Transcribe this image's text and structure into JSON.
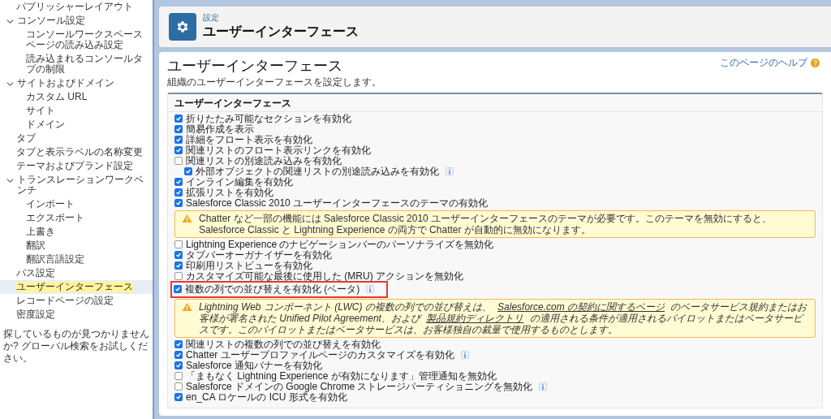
{
  "sidebar": {
    "items": [
      {
        "label": "パブリッシャーレイアウト",
        "selected": false
      },
      {
        "label": "コンソール設定",
        "expanded": true,
        "selected": false,
        "children": [
          {
            "label": "コンソールワークスペースページの読み込み設定",
            "selected": false
          },
          {
            "label": "読み込まれるコンソールタブの制限",
            "selected": false
          }
        ]
      },
      {
        "label": "サイトおよびドメイン",
        "expanded": true,
        "selected": false,
        "children": [
          {
            "label": "カスタム URL",
            "selected": false
          },
          {
            "label": "サイト",
            "selected": false
          },
          {
            "label": "ドメイン",
            "selected": false
          }
        ]
      },
      {
        "label": "タブ",
        "selected": false
      },
      {
        "label": "タブと表示ラベルの名称変更",
        "selected": false
      },
      {
        "label": "テーマおよびブランド設定",
        "selected": false
      },
      {
        "label": "トランスレーションワークベンチ",
        "expanded": true,
        "selected": false,
        "children": [
          {
            "label": "インポート",
            "selected": false
          },
          {
            "label": "エクスポート",
            "selected": false
          },
          {
            "label": "上書き",
            "selected": false
          },
          {
            "label": "翻訳",
            "selected": false
          },
          {
            "label": "翻訳言語設定",
            "selected": false
          }
        ]
      },
      {
        "label": "パス設定",
        "selected": false
      },
      {
        "label": "ユーザーインターフェース",
        "selected": true
      },
      {
        "label": "レコードページの設定",
        "selected": false
      },
      {
        "label": "密度設定",
        "selected": false
      }
    ],
    "footer": "探しているものが見つかりませんか? グローバル検索をお試しください。"
  },
  "header": {
    "breadcrumb": "設定",
    "title": "ユーザーインターフェース"
  },
  "page": {
    "title": "ユーザーインターフェース",
    "help_link": "このページのヘルプ",
    "description": "組織のユーザーインターフェースを設定します。",
    "section": {
      "title": "ユーザーインターフェース",
      "items": [
        {
          "kind": "checkbox",
          "label": "折りたたみ可能なセクションを有効化",
          "checked": true
        },
        {
          "kind": "checkbox",
          "label": "簡易作成を表示",
          "checked": true
        },
        {
          "kind": "checkbox",
          "label": "詳細をフロート表示を有効化",
          "checked": true
        },
        {
          "kind": "checkbox",
          "label": "関連リストのフロート表示リンクを有効化",
          "checked": true
        },
        {
          "kind": "checkbox",
          "label": "関連リストの別途読み込みを有効化",
          "checked": false,
          "children": [
            {
              "kind": "checkbox",
              "label": "外部オブジェクトの関連リストの別途読み込みを有効化",
              "checked": true,
              "info": true
            }
          ]
        },
        {
          "kind": "checkbox",
          "label": "インライン編集を有効化",
          "checked": true
        },
        {
          "kind": "checkbox",
          "label": "拡張リストを有効化",
          "checked": true
        },
        {
          "kind": "checkbox",
          "label": "Salesforce Classic 2010 ユーザーインターフェースのテーマの有効化",
          "checked": true
        },
        {
          "kind": "warning",
          "parts": [
            {
              "kind": "text",
              "text": "Chatter など一部の機能には Salesforce Classic 2010 ユーザーインターフェースのテーマが必要です。このテーマを無効にすると、Salesforce Classic と Lightning Experience の両方で Chatter が自動的に無効になります。"
            }
          ]
        },
        {
          "kind": "checkbox",
          "label": "Lightning Experience のナビゲーションバーのパーソナライズを無効化",
          "checked": false
        },
        {
          "kind": "checkbox",
          "label": "タブバーオーガナイザーを有効化",
          "checked": true
        },
        {
          "kind": "checkbox",
          "label": "印刷用リストビューを有効化",
          "checked": true
        },
        {
          "kind": "checkbox",
          "label": "カスタマイズ可能な最後に使用した (MRU) アクションを無効化",
          "checked": false
        },
        {
          "kind": "checkbox",
          "label": "複数の列での並び替えを有効化 (ベータ)",
          "checked": true,
          "info": true,
          "highlighted": true
        },
        {
          "kind": "warning",
          "italic": true,
          "parts": [
            {
              "kind": "text",
              "text": "Lightning Web コンポーネント (LWC) の複数の列での並び替えは、 "
            },
            {
              "kind": "link",
              "text": "Salesforce.com の契約に関するページ"
            },
            {
              "kind": "text",
              "text": " のベータサービス規約またはお客様が署名された Unified Pilot Agreement、および "
            },
            {
              "kind": "link",
              "text": "製品規約ディレクトリ"
            },
            {
              "kind": "text",
              "text": " の適用される条件が適用されるパイロットまたはベータサービスです。このパイロットまたはベータサービスは、お客様独自の裁量で使用するものとします。"
            }
          ]
        },
        {
          "kind": "checkbox",
          "label": "関連リストの複数の列での並び替えを有効化",
          "checked": true
        },
        {
          "kind": "checkbox",
          "label": "Chatter ユーザープロファイルページのカスタマイズを有効化",
          "checked": true,
          "info": true
        },
        {
          "kind": "checkbox",
          "label": "Salesforce 通知バナーを有効化",
          "checked": true
        },
        {
          "kind": "checkbox",
          "label": "「まもなく Lightning Experience が有効になります」管理通知を無効化",
          "checked": false
        },
        {
          "kind": "checkbox",
          "label": "Salesforce ドメインの Google Chrome ストレージパーティショニングを無効化",
          "checked": false,
          "info": true
        },
        {
          "kind": "checkbox",
          "label": "en_CA ロケールの ICU 形式を有効化",
          "checked": true
        }
      ]
    }
  }
}
